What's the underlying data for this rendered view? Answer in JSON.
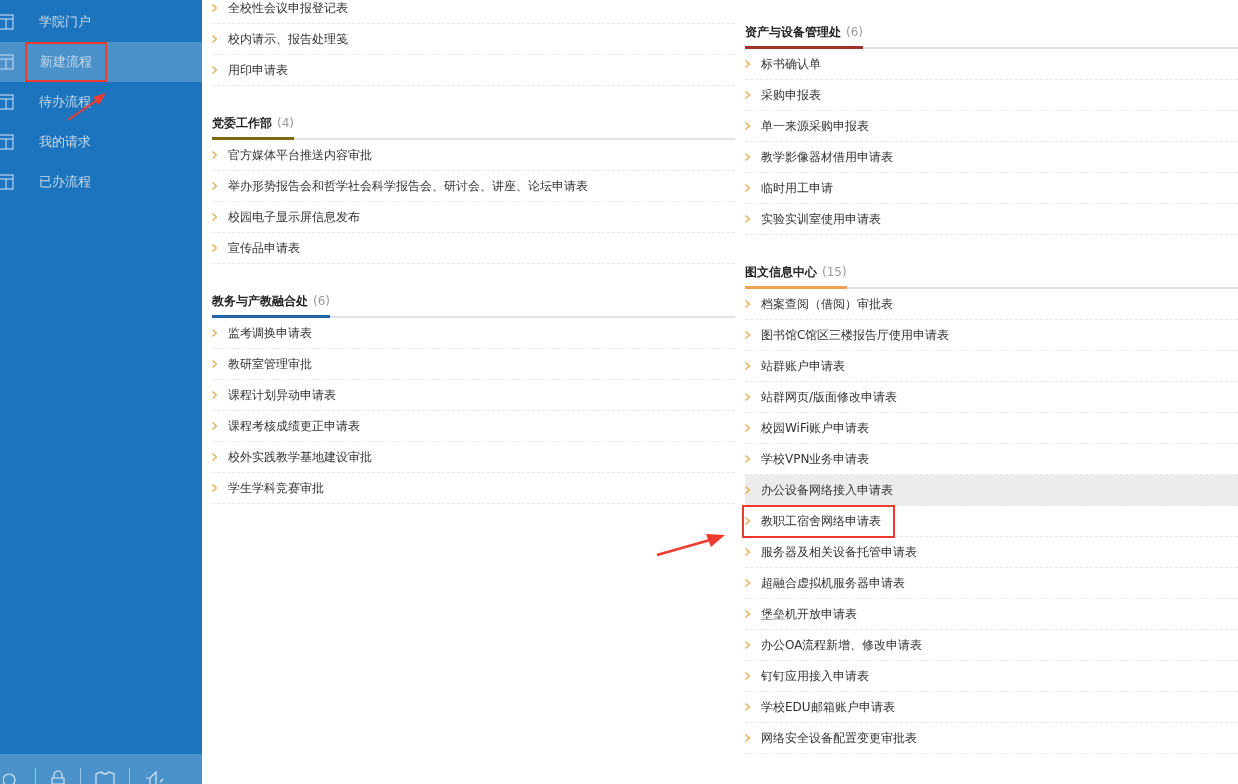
{
  "sidebar": {
    "items": [
      {
        "label": "学院门户",
        "selected": false,
        "annotated": false
      },
      {
        "label": "新建流程",
        "selected": true,
        "annotated": true
      },
      {
        "label": "待办流程",
        "selected": false,
        "annotated": false
      },
      {
        "label": "我的请求",
        "selected": false,
        "annotated": false
      },
      {
        "label": "已办流程",
        "selected": false,
        "annotated": false
      }
    ]
  },
  "columns": [
    {
      "sections": [
        {
          "items": [
            {
              "label": "全校性会议申报登记表",
              "hovered": false,
              "annotated": false
            },
            {
              "label": "校内请示、报告处理笺",
              "hovered": false,
              "annotated": false
            },
            {
              "label": "用印申请表",
              "hovered": false,
              "annotated": false
            }
          ]
        },
        {
          "title": "党委工作部",
          "count": "(4)",
          "color": "#7a6a10",
          "items": [
            {
              "label": "官方媒体平台推送内容审批",
              "hovered": false,
              "annotated": false
            },
            {
              "label": "举办形势报告会和哲学社会科学报告会、研讨会、讲座、论坛申请表",
              "hovered": false,
              "annotated": false
            },
            {
              "label": "校园电子显示屏信息发布",
              "hovered": false,
              "annotated": false
            },
            {
              "label": "宣传品申请表",
              "hovered": false,
              "annotated": false
            }
          ]
        },
        {
          "title": "教务与产教融合处",
          "count": "(6)",
          "color": "#1f62a8",
          "items": [
            {
              "label": "监考调换申请表",
              "hovered": false,
              "annotated": false
            },
            {
              "label": "教研室管理审批",
              "hovered": false,
              "annotated": false
            },
            {
              "label": "课程计划异动申请表",
              "hovered": false,
              "annotated": false
            },
            {
              "label": "课程考核成绩更正申请表",
              "hovered": false,
              "annotated": false
            },
            {
              "label": "校外实践教学基地建设审批",
              "hovered": false,
              "annotated": false
            },
            {
              "label": "学生学科竞赛审批",
              "hovered": false,
              "annotated": false
            }
          ]
        }
      ]
    },
    {
      "sections": [
        {
          "title": "资产与设备管理处",
          "count": "(6)",
          "color": "#a03328",
          "items": [
            {
              "label": "标书确认单",
              "hovered": false,
              "annotated": false
            },
            {
              "label": "采购申报表",
              "hovered": false,
              "annotated": false
            },
            {
              "label": "单一来源采购申报表",
              "hovered": false,
              "annotated": false
            },
            {
              "label": "教学影像器材借用申请表",
              "hovered": false,
              "annotated": false
            },
            {
              "label": "临时用工申请",
              "hovered": false,
              "annotated": false
            },
            {
              "label": "实验实训室使用申请表",
              "hovered": false,
              "annotated": false
            }
          ]
        },
        {
          "title": "图文信息中心",
          "count": "(15)",
          "color": "#f0a050",
          "items": [
            {
              "label": "档案查阅（借阅）审批表",
              "hovered": false,
              "annotated": false
            },
            {
              "label": "图书馆C馆区三楼报告厅使用申请表",
              "hovered": false,
              "annotated": false
            },
            {
              "label": "站群账户申请表",
              "hovered": false,
              "annotated": false
            },
            {
              "label": "站群网页/版面修改申请表",
              "hovered": false,
              "annotated": false
            },
            {
              "label": "校园WiFi账户申请表",
              "hovered": false,
              "annotated": false
            },
            {
              "label": "学校VPN业务申请表",
              "hovered": false,
              "annotated": false
            },
            {
              "label": "办公设备网络接入申请表",
              "hovered": true,
              "annotated": false
            },
            {
              "label": "教职工宿舍网络申请表",
              "hovered": false,
              "annotated": true
            },
            {
              "label": "服务器及相关设备托管申请表",
              "hovered": false,
              "annotated": false
            },
            {
              "label": "超融合虚拟机服务器申请表",
              "hovered": false,
              "annotated": false
            },
            {
              "label": "堡垒机开放申请表",
              "hovered": false,
              "annotated": false
            },
            {
              "label": "办公OA流程新增、修改申请表",
              "hovered": false,
              "annotated": false
            },
            {
              "label": "钉钉应用接入申请表",
              "hovered": false,
              "annotated": false
            },
            {
              "label": "学校EDU邮箱账户申请表",
              "hovered": false,
              "annotated": false
            },
            {
              "label": "网络安全设备配置变更审批表",
              "hovered": false,
              "annotated": false
            }
          ]
        }
      ]
    }
  ]
}
